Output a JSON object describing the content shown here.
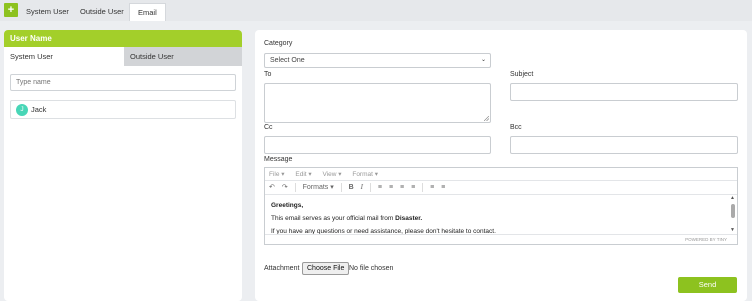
{
  "top_tabs": {
    "add_label": "+",
    "items": [
      {
        "label": "System User"
      },
      {
        "label": "Outside User"
      },
      {
        "label": "Email"
      }
    ]
  },
  "left_panel": {
    "header": "User Name",
    "tabs": [
      {
        "label": "System User"
      },
      {
        "label": "Outside User"
      }
    ],
    "search_placeholder": "Type name",
    "users": [
      {
        "initial": "J",
        "name": "Jack"
      }
    ]
  },
  "form": {
    "category_label": "Category",
    "category_value": "Select One",
    "to_label": "To",
    "subject_label": "Subject",
    "cc_label": "Cc",
    "bcc_label": "Bcc",
    "message_label": "Message",
    "editor": {
      "menu": [
        "File",
        "Edit",
        "View",
        "Format"
      ],
      "formats_label": "Formats",
      "greeting": "Greetings,",
      "line1_prefix": "This email serves as your official mail from ",
      "line1_bold": "Disaster.",
      "line2": "If you have any questions or need assistance, please don't hesitate to contact.",
      "powered_by": "POWERED BY TINY"
    },
    "attachment_label": "Attachment",
    "choose_file_label": "Choose File",
    "no_file_text": "No file chosen",
    "send_label": "Send"
  }
}
